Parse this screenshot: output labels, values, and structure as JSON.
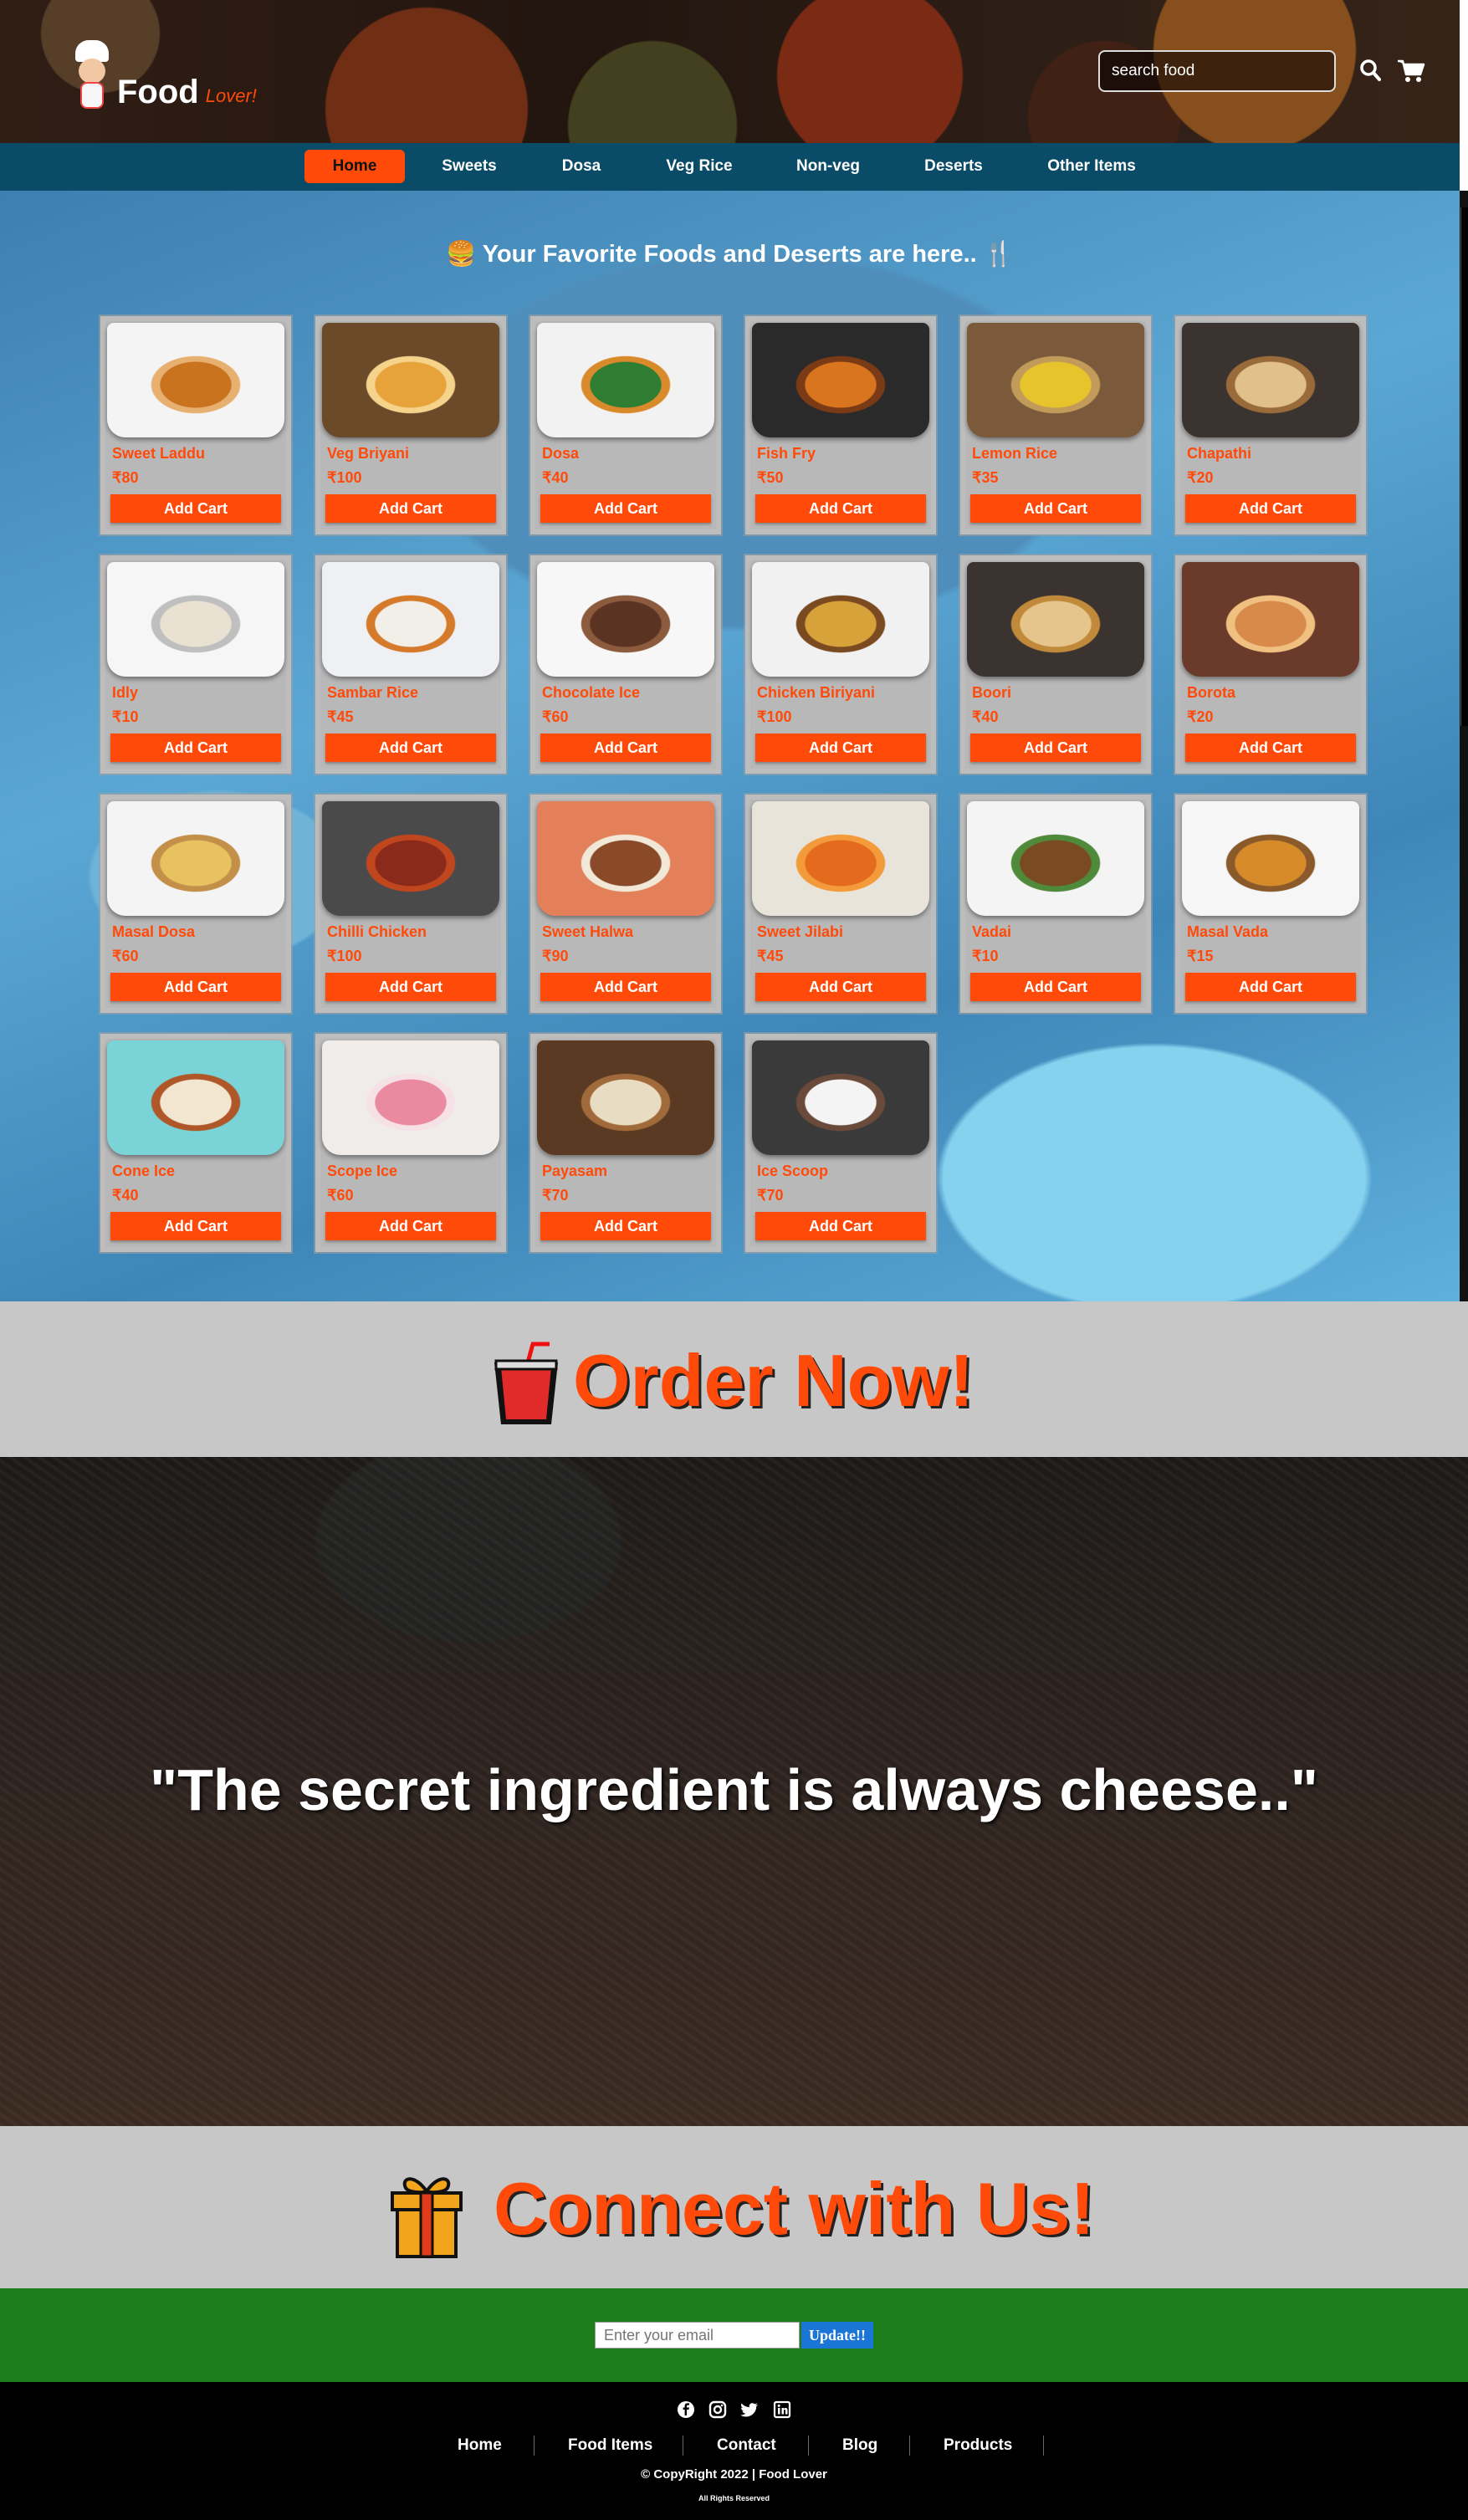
{
  "header": {
    "logo_main": "Food",
    "logo_sub": "Lover!",
    "search_placeholder": "search food"
  },
  "nav": {
    "items": [
      {
        "label": "Home",
        "active": true
      },
      {
        "label": "Sweets"
      },
      {
        "label": "Dosa"
      },
      {
        "label": "Veg Rice"
      },
      {
        "label": "Non-veg"
      },
      {
        "label": "Deserts"
      },
      {
        "label": "Other Items"
      }
    ]
  },
  "main": {
    "title": "Your Favorite Foods and Deserts are here..",
    "button_label": "Add Cart",
    "products": [
      {
        "name": "Sweet Laddu",
        "price": "₹80"
      },
      {
        "name": "Veg Briyani",
        "price": "₹100"
      },
      {
        "name": "Dosa",
        "price": "₹40"
      },
      {
        "name": "Fish Fry",
        "price": "₹50"
      },
      {
        "name": "Lemon Rice",
        "price": "₹35"
      },
      {
        "name": "Chapathi",
        "price": "₹20"
      },
      {
        "name": "Idly",
        "price": "₹10"
      },
      {
        "name": "Sambar Rice",
        "price": "₹45"
      },
      {
        "name": "Chocolate Ice",
        "price": "₹60"
      },
      {
        "name": "Chicken Biriyani",
        "price": "₹100"
      },
      {
        "name": "Boori",
        "price": "₹40"
      },
      {
        "name": "Borota",
        "price": "₹20"
      },
      {
        "name": "Masal Dosa",
        "price": "₹60"
      },
      {
        "name": "Chilli Chicken",
        "price": "₹100"
      },
      {
        "name": "Sweet Halwa",
        "price": "₹90"
      },
      {
        "name": "Sweet Jilabi",
        "price": "₹45"
      },
      {
        "name": "Vadai",
        "price": "₹10"
      },
      {
        "name": "Masal Vada",
        "price": "₹15"
      },
      {
        "name": "Cone Ice",
        "price": "₹40"
      },
      {
        "name": "Scope Ice",
        "price": "₹60"
      },
      {
        "name": "Payasam",
        "price": "₹70"
      },
      {
        "name": "Ice Scoop",
        "price": "₹70"
      }
    ]
  },
  "order": {
    "heading": "Order Now!"
  },
  "quote": {
    "text": "\"The secret ingredient is always cheese..\""
  },
  "connect": {
    "heading": "Connect with Us!"
  },
  "newsletter": {
    "placeholder": "Enter your email",
    "button_label": "Update!!"
  },
  "footer": {
    "links": [
      "Home",
      "Food Items",
      "Contact",
      "Blog",
      "Products"
    ],
    "social_icons": [
      "facebook-icon",
      "instagram-icon",
      "twitter-icon",
      "linkedin-icon"
    ],
    "copyright": "© CopyRight 2022 | Food Lover",
    "rights": "All Rights Reserved"
  },
  "colors": {
    "accent": "#ff4a0a",
    "nav": "#0a4c67",
    "newsletter": "#1e7e1e",
    "update_button": "#1a75d6"
  }
}
